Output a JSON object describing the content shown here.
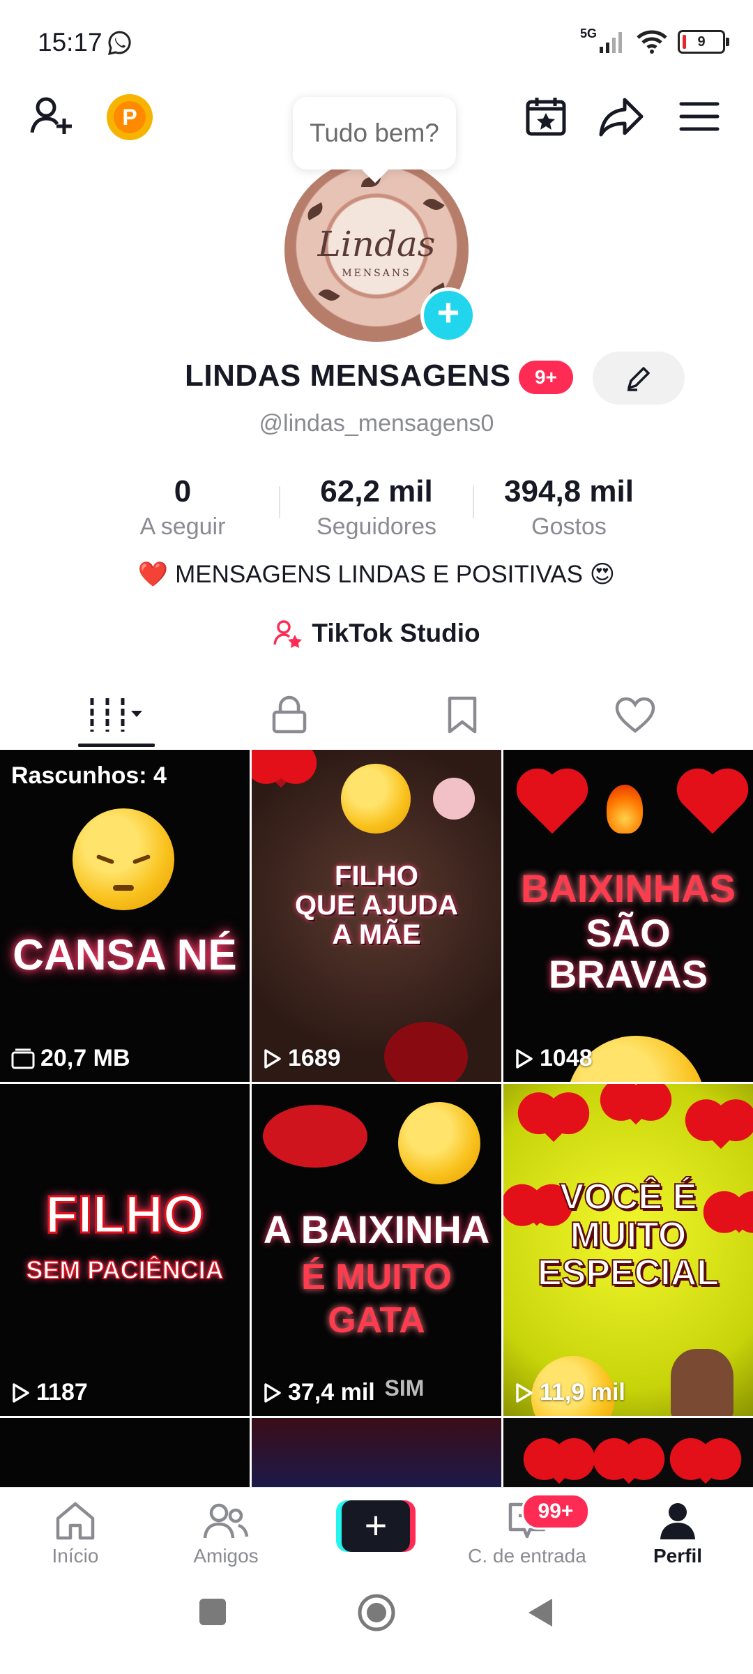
{
  "status_bar": {
    "time": "15:17",
    "network": "5G",
    "battery": "9",
    "icons": [
      "whatsapp-icon",
      "signal-icon",
      "wifi-icon",
      "battery-icon"
    ]
  },
  "header": {
    "tooltip": "Tudo bem?",
    "icons": [
      "add-friend-icon",
      "coin-icon",
      "calendar-star-icon",
      "share-icon",
      "menu-icon"
    ],
    "coin_letter": "P"
  },
  "profile": {
    "avatar_script": "Lindas",
    "avatar_sub": "MENSANS",
    "display_name": "LINDAS MENSAGENS",
    "name_badge": "9+",
    "username": "@lindas_mensagens0",
    "stats": [
      {
        "value": "0",
        "label": "A seguir"
      },
      {
        "value": "62,2 mil",
        "label": "Seguidores"
      },
      {
        "value": "394,8 mil",
        "label": "Gostos"
      }
    ],
    "bio_text": "MENSAGENS LINDAS E POSITIVAS",
    "bio_emoji_left": "❤️",
    "bio_emoji_right": "😍",
    "studio_label": "TikTok Studio"
  },
  "tabs": [
    "videos-tab",
    "private-tab",
    "saved-tab",
    "liked-tab"
  ],
  "grid": {
    "tiles": [
      {
        "overlay": "Rascunhos: 4",
        "text": "CANSA NÉ",
        "meta": "20,7 MB"
      },
      {
        "text_lines": [
          "FILHO",
          "QUE AJUDA",
          "A MÃE"
        ],
        "meta": "1689"
      },
      {
        "text_lines": [
          "BAIXINHAS",
          "SÃO BRAVAS"
        ],
        "meta": "1048"
      },
      {
        "text_lines": [
          "FILHO",
          "SEM PACIÊNCIA"
        ],
        "meta": "1187"
      },
      {
        "text_lines": [
          "A BAIXINHA",
          "É MUITO",
          "GATA"
        ],
        "extra": "SIM",
        "meta": "37,4 mil"
      },
      {
        "text_lines": [
          "VOCÊ É",
          "MUITO",
          "ESPECIAL"
        ],
        "meta": "11,9 mil"
      }
    ]
  },
  "bottom_nav": {
    "items": [
      {
        "label": "Início",
        "icon": "home-icon"
      },
      {
        "label": "Amigos",
        "icon": "friends-icon"
      },
      {
        "label": "",
        "icon": "create-icon"
      },
      {
        "label": "C. de entrada",
        "icon": "inbox-icon"
      },
      {
        "label": "Perfil",
        "icon": "profile-icon"
      }
    ],
    "inbox_badge": "99+"
  },
  "colors": {
    "accent_red": "#fe2c55",
    "accent_cyan": "#20d5ec",
    "text_primary": "#161823",
    "text_secondary": "#8a8b91"
  }
}
